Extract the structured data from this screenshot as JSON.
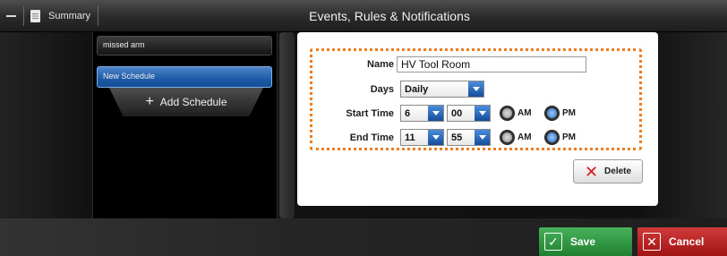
{
  "titlebar": {
    "minimize_icon": "minus-icon",
    "doc_icon": "document-icon",
    "summary_label": "Summary",
    "title": "Events, Rules & Notifications"
  },
  "schedules": {
    "items": [
      {
        "label": "missed arm",
        "selected": false
      },
      {
        "label": "New Schedule",
        "selected": true
      }
    ],
    "add_label": "Add Schedule",
    "add_icon": "plus-icon"
  },
  "form": {
    "name_label": "Name",
    "name_value": "HV Tool Room",
    "days_label": "Days",
    "days_value": "Daily",
    "start_label": "Start Time",
    "start_hour": "6",
    "start_minute": "00",
    "start_ampm": "PM",
    "end_label": "End Time",
    "end_hour": "11",
    "end_minute": "55",
    "end_ampm": "PM",
    "am_label": "AM",
    "pm_label": "PM",
    "delete_label": "Delete",
    "delete_icon": "x-icon"
  },
  "footer": {
    "save_label": "Save",
    "save_icon": "check-icon",
    "cancel_label": "Cancel",
    "cancel_icon": "x-icon"
  },
  "colors": {
    "accent_blue": "#1d5aa8",
    "highlight_orange": "#ee7d1f",
    "save_green": "#2e9a43",
    "cancel_red": "#c62828"
  }
}
